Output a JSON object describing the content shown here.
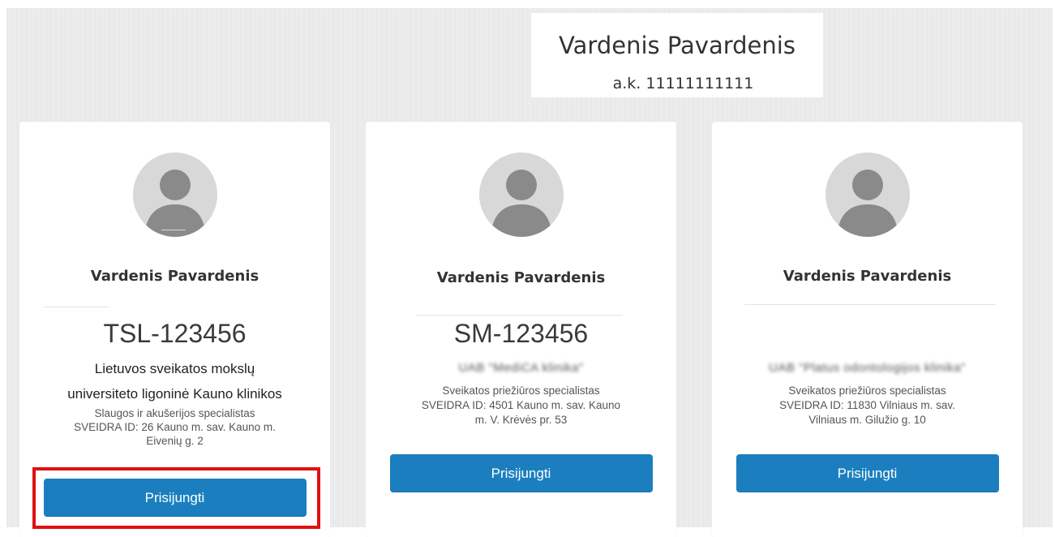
{
  "patient": {
    "name": "Vardenis Pavardenis",
    "code": "a.k. 11111111111"
  },
  "cards": [
    {
      "name": "Vardenis Pavardenis",
      "license": "TSL-123456",
      "institution_line1": "Lietuvos sveikatos mokslų",
      "institution_line2": "universiteto ligoninė Kauno klinikos",
      "specialty": "Slaugos ir akušerijos specialistas",
      "sveidra_line1": "SVEIDRA ID: 26 Kauno m. sav. Kauno m.",
      "sveidra_line2": "Eivenių g. 2",
      "button": "Prisijungti"
    },
    {
      "name": "Vardenis Pavardenis",
      "license": "SM-123456",
      "institution_blurred": "UAB \"MediCA klinika\"",
      "specialty": "Sveikatos priežiūros specialistas",
      "sveidra_line1": "SVEIDRA ID: 4501 Kauno m. sav. Kauno",
      "sveidra_line2": "m. V. Krėvės pr. 53",
      "button": "Prisijungti"
    },
    {
      "name": "Vardenis Pavardenis",
      "institution_blurred": "UAB \"Platus odontologijos klinika\"",
      "specialty": "Sveikatos priežiūros specialistas",
      "sveidra_line1": "SVEIDRA ID: 11830 Vilniaus m. sav.",
      "sveidra_line2": "Vilniaus m. Gilužio g. 10",
      "button": "Prisijungti"
    }
  ],
  "colors": {
    "button": "#1b7fbf",
    "highlight": "#e01010",
    "background": "#ececec"
  }
}
